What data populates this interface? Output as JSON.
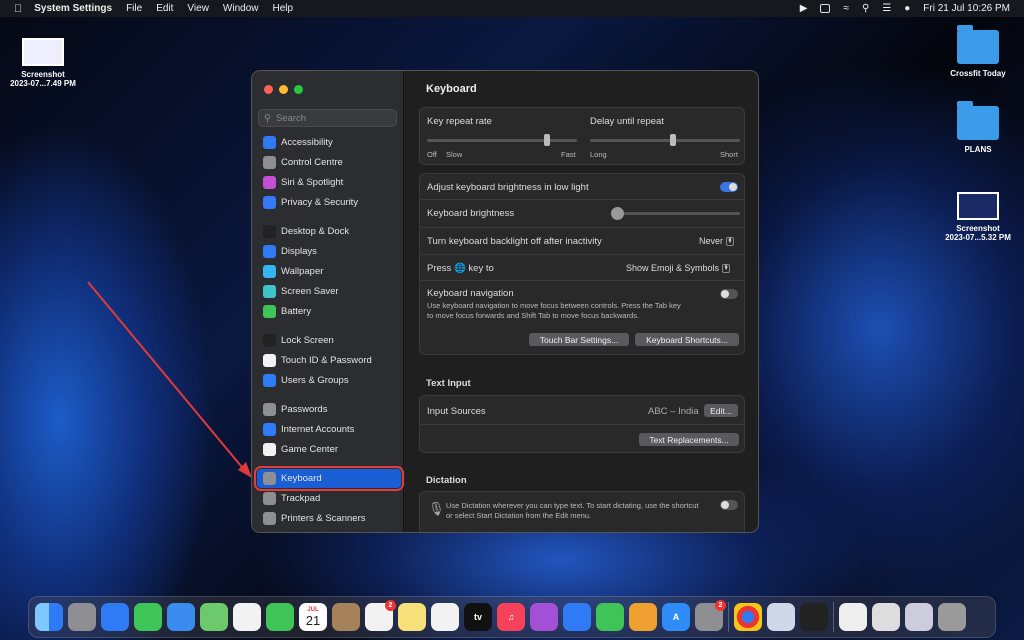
{
  "menubar": {
    "app": "System Settings",
    "menus": [
      "File",
      "Edit",
      "View",
      "Window",
      "Help"
    ],
    "datetime": "Fri 21 Jul  10:26 PM"
  },
  "desktop": {
    "icons": [
      {
        "label1": "Screenshot",
        "label2": "2023-07...7.49 PM",
        "kind": "thumb"
      },
      {
        "label1": "Crossfit Today",
        "label2": "",
        "kind": "folder"
      },
      {
        "label1": "PLANS",
        "label2": "",
        "kind": "folder"
      },
      {
        "label1": "Screenshot",
        "label2": "2023-07...5.32 PM",
        "kind": "thumb"
      }
    ]
  },
  "sidebar": {
    "search_placeholder": "Search",
    "items": [
      {
        "label": "Accessibility",
        "color": "#2f7bf6"
      },
      {
        "label": "Control Centre",
        "color": "#8e8e93"
      },
      {
        "label": "Siri & Spotlight",
        "color": "#c44fd6"
      },
      {
        "label": "Privacy & Security",
        "color": "#3478f6"
      },
      {
        "label": "Desktop & Dock",
        "color": "#222222"
      },
      {
        "label": "Displays",
        "color": "#2f7bf6"
      },
      {
        "label": "Wallpaper",
        "color": "#35b6f0"
      },
      {
        "label": "Screen Saver",
        "color": "#3fc4c9"
      },
      {
        "label": "Battery",
        "color": "#3fc458"
      },
      {
        "label": "Lock Screen",
        "color": "#222222"
      },
      {
        "label": "Touch ID & Password",
        "color": "#f2f2f2"
      },
      {
        "label": "Users & Groups",
        "color": "#2f7bf6"
      },
      {
        "label": "Passwords",
        "color": "#8e8e93"
      },
      {
        "label": "Internet Accounts",
        "color": "#2f7bf6"
      },
      {
        "label": "Game Center",
        "color": "#f2f2f2"
      },
      {
        "label": "Keyboard",
        "color": "#8e8e93"
      },
      {
        "label": "Trackpad",
        "color": "#8e8e93"
      },
      {
        "label": "Printers & Scanners",
        "color": "#8e8e93"
      }
    ]
  },
  "main": {
    "title": "Keyboard",
    "repeat": {
      "rate_label": "Key repeat rate",
      "delay_label": "Delay until repeat",
      "off": "Off",
      "slow": "Slow",
      "fast": "Fast",
      "long": "Long",
      "short": "Short",
      "rate_level": 0.8,
      "delay_level": 0.55
    },
    "brightness_low_light": "Adjust keyboard brightness in low light",
    "brightness": "Keyboard brightness",
    "backlight_off": "Turn keyboard backlight off after inactivity",
    "backlight_value": "Never",
    "press_key_prefix": "Press",
    "press_key_suffix": "key to",
    "press_key_value": "Show Emoji & Symbols",
    "nav_title": "Keyboard navigation",
    "nav_desc1": "Use keyboard navigation to move focus between controls. Press the Tab key",
    "nav_desc2": "to move focus forwards and Shift Tab to move focus backwards.",
    "touchbar_btn": "Touch Bar Settings...",
    "shortcuts_btn": "Keyboard Shortcuts...",
    "text_input_title": "Text Input",
    "input_sources": "Input Sources",
    "input_sources_value": "ABC – India",
    "edit_btn": "Edit...",
    "text_repl_btn": "Text Replacements...",
    "dictation_title": "Dictation",
    "dict_desc1": "Use Dictation wherever you can type text. To start dictating, use the shortcut",
    "dict_desc2": "or select Start Dictation from the Edit menu."
  },
  "dock": {
    "calendar_month": "JUL",
    "calendar_day": "21",
    "tv": "tv",
    "badge_reminders": "2",
    "badge_settings": "2"
  }
}
